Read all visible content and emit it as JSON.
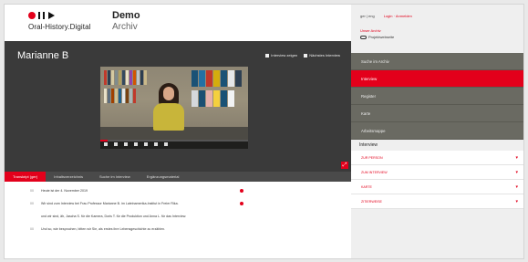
{
  "header": {
    "logo_text": "Oral-History.Digital",
    "title": "Demo",
    "subtitle": "Archiv"
  },
  "player": {
    "person_name": "Marianne B",
    "action_1": "Interview zeigen",
    "action_2": "Nächstes Interview",
    "progress": 0.05
  },
  "tabs": [
    {
      "label": "Transkript (ger)"
    },
    {
      "label": "Inhaltsverzeichnis"
    },
    {
      "label": "Suche im Interview"
    },
    {
      "label": "Ergänzungsmaterial"
    }
  ],
  "transcript": [
    {
      "num": "00",
      "text": "Heute ist der 4. November 2019"
    },
    {
      "num": "00",
      "text": "Wir sind zum Interview bei Frau Professor Marianne B. im Lateinamerika-Institut in Freier Rika."
    },
    {
      "num": "",
      "text": "und wir sind, äh, Jascha S. für die Kamera, Doris T. für die Produktion und Anna L. für das Interview."
    },
    {
      "num": "00",
      "text": "Und so, wie besprochen, bitten wir Sie, als erstes ihre Lebensgeschichte zu erzählen."
    }
  ],
  "sidebar": {
    "lang_current": "ger",
    "lang_other": "eng",
    "login_text": "Login · Anmelden",
    "archive_label": "Unser Archiv",
    "archive_link": "Projektwebseite",
    "nav": [
      {
        "label": "Suche im Archiv"
      },
      {
        "label": "Interview"
      },
      {
        "label": "Register"
      },
      {
        "label": "Karte"
      },
      {
        "label": "Arbeitsmappe"
      }
    ],
    "section_title": "Interview",
    "accordion": [
      {
        "label": "ZUR PERSON"
      },
      {
        "label": "ZUM INTERVIEW"
      },
      {
        "label": "KARTE"
      },
      {
        "label": "ZITIERWEISE"
      }
    ]
  },
  "colors": {
    "accent": "#e3001b",
    "player_bg": "#3a3a3a",
    "nav_bg": "#6a6a62"
  }
}
